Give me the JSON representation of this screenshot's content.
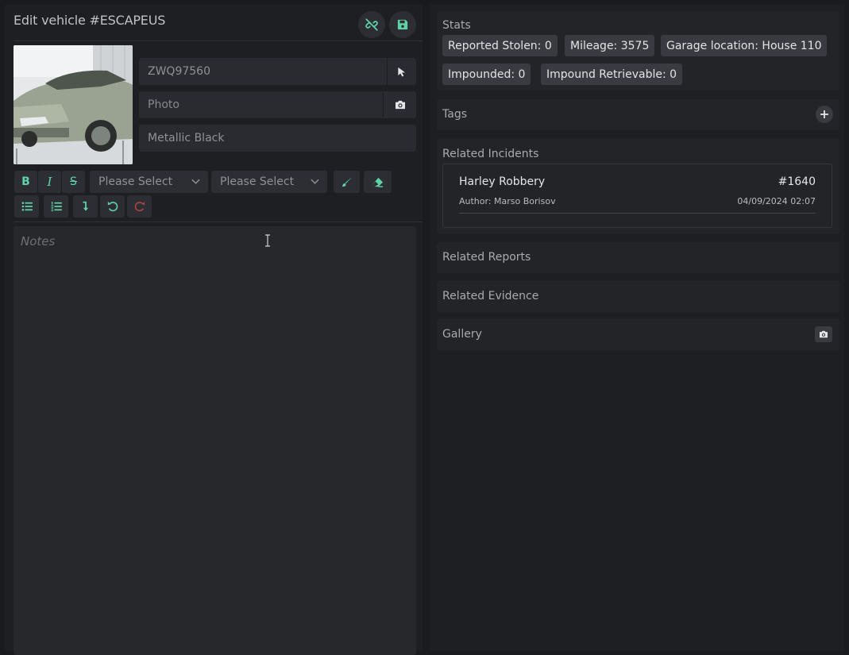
{
  "header": {
    "title": "Edit vehicle #ESCAPEUS",
    "unlink_icon": "unlink-icon",
    "save_icon": "floppy-disk-icon"
  },
  "vehicle": {
    "plate": "ZWQ97560",
    "photo_placeholder": "Photo",
    "color": "Metallic Black",
    "photo_subject": "silver-green sports car"
  },
  "toolbar": {
    "bold": "B",
    "italic": "I",
    "strikethrough": "S",
    "select1": "Please Select",
    "select2": "Please Select"
  },
  "notes": {
    "placeholder": "Notes"
  },
  "stats": {
    "title": "Stats",
    "chips": [
      "Reported Stolen: 0",
      "Mileage: 3575",
      "Garage location: House 110",
      "Impounded: 0",
      "Impound Retrievable: 0"
    ]
  },
  "tags": {
    "title": "Tags"
  },
  "related_incidents": {
    "title": "Related Incidents",
    "items": [
      {
        "name": "Harley Robbery",
        "id": "#1640",
        "author": "Author: Marso Borisov",
        "date": "04/09/2024 02:07"
      }
    ]
  },
  "related_reports": {
    "title": "Related Reports"
  },
  "related_evidence": {
    "title": "Related Evidence"
  },
  "gallery": {
    "title": "Gallery"
  },
  "colors": {
    "accent": "#5fd3a8",
    "panel": "#1e1f23",
    "field": "#2a2b30",
    "redo_disabled": "#a84545"
  }
}
